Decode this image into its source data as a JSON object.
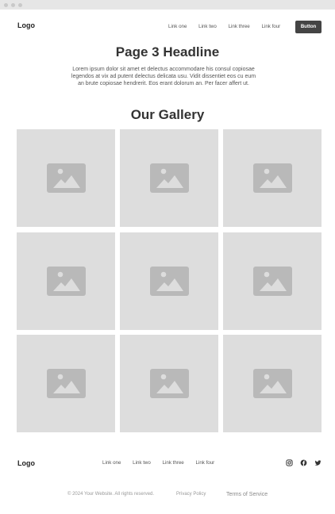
{
  "header": {
    "logo": "Logo",
    "links": [
      "Link one",
      "Link two",
      "Link three",
      "Link four"
    ],
    "button_label": "Button"
  },
  "hero": {
    "headline": "Page 3 Headline",
    "body": "Lorem ipsum dolor sit amet et delectus accommodare his consul copiosae legendos at vix ad putent delectus delicata usu. Vidit dissentiet eos cu eum an brute copiosae hendrerit. Eos erant dolorum an. Per facer affert ut."
  },
  "gallery": {
    "title": "Our Gallery",
    "tile_count": 9,
    "placeholder_icon": "image-placeholder-icon",
    "colors": {
      "tile": "#dddddd",
      "icon": "#b9b9b9"
    }
  },
  "footer": {
    "logo": "Logo",
    "links": [
      "Link one",
      "Link two",
      "Link three",
      "Link four"
    ],
    "social_icons": [
      "instagram-icon",
      "facebook-icon",
      "twitter-icon"
    ],
    "copyright": "© 2024 Your Website. All rights reserved.",
    "privacy": "Privacy Policy",
    "terms": "Terms of Service"
  },
  "colors": {
    "button": "#444444",
    "text": "#333333",
    "muted": "#999999"
  }
}
